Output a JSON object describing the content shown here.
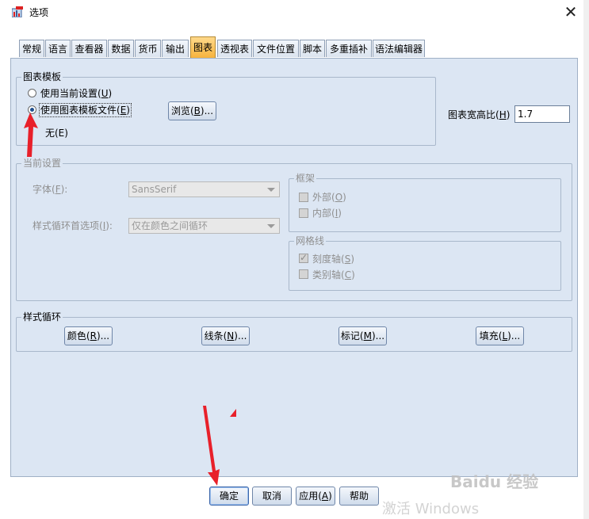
{
  "window": {
    "title": "选项",
    "close_label": "✕"
  },
  "tabs": [
    {
      "label": "常规"
    },
    {
      "label": "语言"
    },
    {
      "label": "查看器"
    },
    {
      "label": "数据"
    },
    {
      "label": "货币"
    },
    {
      "label": "输出"
    },
    {
      "label": "图表",
      "active": true
    },
    {
      "label": "透视表"
    },
    {
      "label": "文件位置"
    },
    {
      "label": "脚本"
    },
    {
      "label": "多重插补"
    },
    {
      "label": "语法编辑器"
    }
  ],
  "chart_template": {
    "legend": "图表模板",
    "option_current": {
      "text": "使用当前设置(",
      "key": "U",
      "tail": ")"
    },
    "option_file": {
      "text": "使用图表模板文件(",
      "key": "E",
      "tail": ")"
    },
    "browse": {
      "text": "浏览(",
      "key": "B",
      "tail": ")..."
    },
    "file_value": "无(E)"
  },
  "aspect_ratio": {
    "label": "图表宽高比(",
    "key": "H",
    "tail": ")",
    "value": "1.7"
  },
  "current_settings": {
    "legend": "当前设置",
    "font_label": {
      "text": "字体(",
      "key": "F",
      "tail": "):"
    },
    "font_value": "SansSerif",
    "cycle_label": {
      "text": "样式循环首选项(",
      "key": "I",
      "tail": "):"
    },
    "cycle_value": "仅在颜色之间循环",
    "frame": {
      "legend": "框架",
      "outer": {
        "text": "外部(",
        "key": "O",
        "tail": ")"
      },
      "inner": {
        "text": "内部(",
        "key": "I",
        "tail": ")"
      }
    },
    "gridlines": {
      "legend": "网格线",
      "scale": {
        "text": "刻度轴(",
        "key": "S",
        "tail": ")"
      },
      "category": {
        "text": "类别轴(",
        "key": "C",
        "tail": ")"
      }
    }
  },
  "style_cycle": {
    "legend": "样式循环",
    "colors": {
      "text": "颜色(",
      "key": "R",
      "tail": ")..."
    },
    "lines": {
      "text": "线条(",
      "key": "N",
      "tail": ")..."
    },
    "markers": {
      "text": "标记(",
      "key": "M",
      "tail": ")..."
    },
    "fills": {
      "text": "填充(",
      "key": "L",
      "tail": ")..."
    }
  },
  "footer": {
    "ok": "确定",
    "cancel": "取消",
    "apply": {
      "text": "应用(",
      "key": "A",
      "tail": ")"
    },
    "help": "帮助"
  },
  "watermark": {
    "text1": "激活 Windows",
    "text2": "Baidu 经验"
  },
  "colors": {
    "panel_bg": "#dce6f3",
    "active_tab": "#f6b33d",
    "annotation_red": "#e8202a"
  }
}
